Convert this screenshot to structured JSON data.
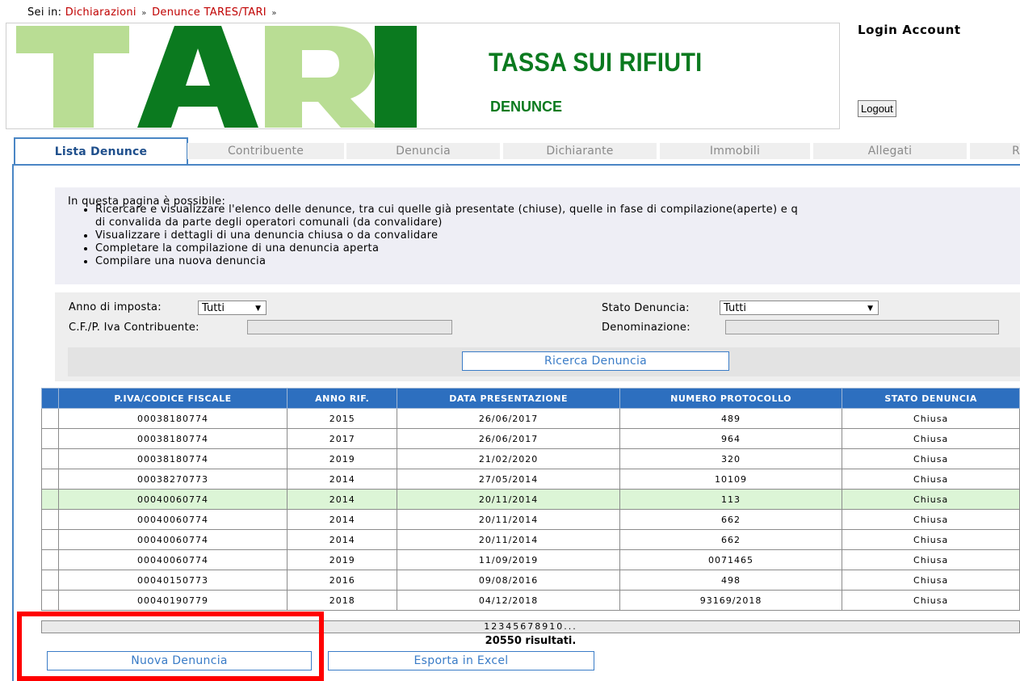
{
  "breadcrumb": {
    "prefix": "Sei in:",
    "items": [
      "Dichiarazioni",
      "Denunce TARES/TARI"
    ],
    "separator": "»"
  },
  "header": {
    "logo_text": "TARI",
    "title": "TASSA SUI RIFIUTI",
    "subtitle": "DENUNCE"
  },
  "account": {
    "title": "Login Account",
    "logout_label": "Logout"
  },
  "tabs": [
    {
      "label": "Lista Denunce",
      "active": true
    },
    {
      "label": "Contribuente"
    },
    {
      "label": "Denuncia"
    },
    {
      "label": "Dichiarante"
    },
    {
      "label": "Immobili"
    },
    {
      "label": "Allegati"
    },
    {
      "label": "R"
    }
  ],
  "info": {
    "intro": "In questa pagina è possibile:",
    "items": [
      "Ricercare e visualizzare l'elenco delle denunce, tra cui quelle già presentate (chiuse), quelle in fase di compilazione(aperte) e q",
      "di convalida da parte degli operatori comunali (da convalidare)",
      "Visualizzare i dettagli di una denuncia chiusa o da convalidare",
      "Completare la compilazione di una denuncia aperta",
      "Compilare una nuova denuncia"
    ]
  },
  "search": {
    "anno_label": "Anno di imposta:",
    "anno_value": "Tutti",
    "stato_label": "Stato Denuncia:",
    "stato_value": "Tutti",
    "cf_label": "C.F./P. Iva Contribuente:",
    "cf_value": "",
    "denom_label": "Denominazione:",
    "denom_value": "",
    "button_label": "Ricerca Denuncia"
  },
  "table": {
    "columns": [
      "P.IVA/CODICE FISCALE",
      "ANNO RIF.",
      "DATA PRESENTAZIONE",
      "NUMERO PROTOCOLLO",
      "STATO DENUNCIA"
    ],
    "rows": [
      [
        "00038180774",
        "2015",
        "26/06/2017",
        "489",
        "Chiusa"
      ],
      [
        "00038180774",
        "2017",
        "26/06/2017",
        "964",
        "Chiusa"
      ],
      [
        "00038180774",
        "2019",
        "21/02/2020",
        "320",
        "Chiusa"
      ],
      [
        "00038270773",
        "2014",
        "27/05/2014",
        "10109",
        "Chiusa"
      ],
      [
        "00040060774",
        "2014",
        "20/11/2014",
        "113",
        "Chiusa"
      ],
      [
        "00040060774",
        "2014",
        "20/11/2014",
        "662",
        "Chiusa"
      ],
      [
        "00040060774",
        "2014",
        "20/11/2014",
        "662",
        "Chiusa"
      ],
      [
        "00040060774",
        "2019",
        "11/09/2019",
        "0071465",
        "Chiusa"
      ],
      [
        "00040150773",
        "2016",
        "09/08/2016",
        "498",
        "Chiusa"
      ],
      [
        "00040190779",
        "2018",
        "04/12/2018",
        "93169/2018",
        "Chiusa"
      ]
    ],
    "highlighted_row": 4,
    "pager": [
      "1",
      "2",
      "3",
      "4",
      "5",
      "6",
      "7",
      "8",
      "9",
      "10",
      "..."
    ],
    "result_count": "20550 risultati."
  },
  "actions": {
    "new_label": "Nuova Denuncia",
    "export_label": "Esporta in Excel"
  },
  "colors": {
    "header_green": "#0b7a1f",
    "logo_light": "#b9dd94",
    "logo_dark": "#0b7a1f",
    "accent_blue": "#2d6fbf",
    "highlight_red": "#ff0000"
  }
}
